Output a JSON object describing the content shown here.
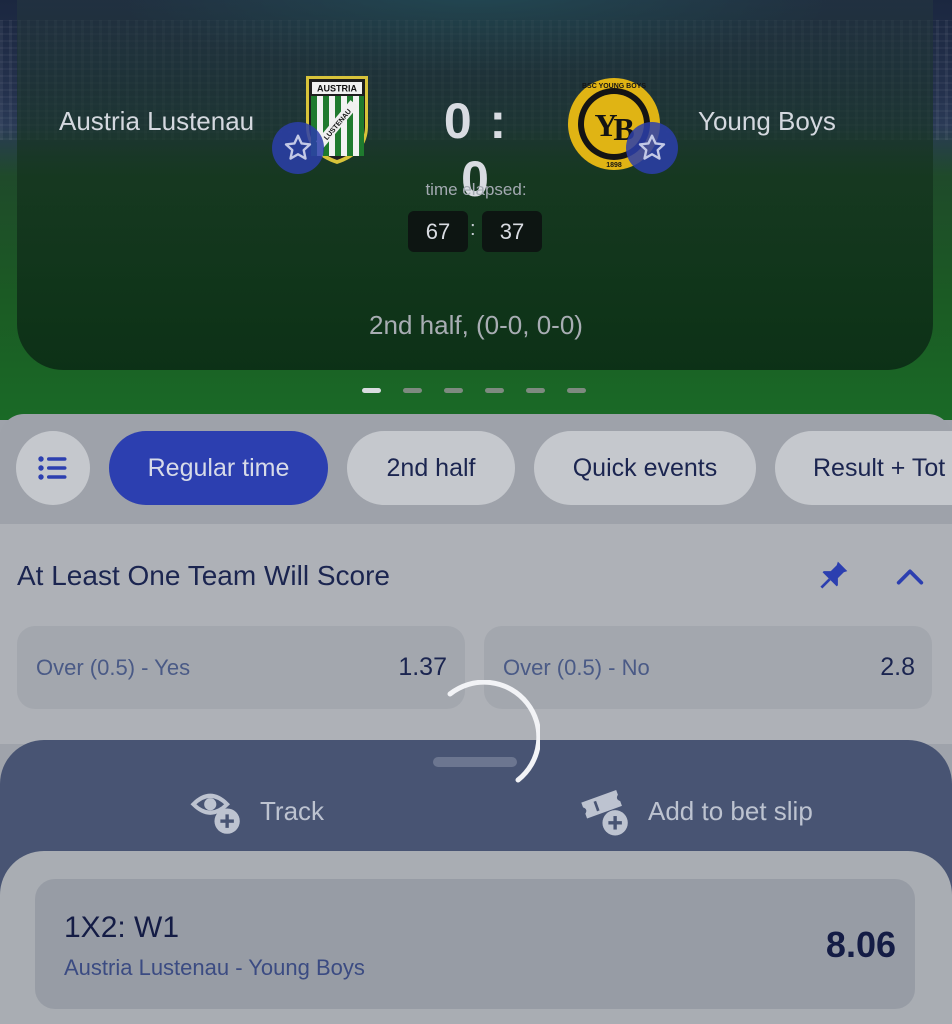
{
  "match": {
    "home_team": "Austria Lustenau",
    "away_team": "Young Boys",
    "home_crest_text": "AUSTRIA",
    "home_crest_sub": "LUSTENAU",
    "away_crest_text": "BSC YOUNG BOYS",
    "away_crest_year": "1898",
    "score": "0 : 0",
    "elapsed_label": "time elapsed:",
    "elapsed_minutes": "67",
    "elapsed_seconds": "37",
    "period": "2nd half, (0-0, 0-0)",
    "carousel_pages": 6,
    "carousel_active": 0
  },
  "tabs": [
    {
      "label": "Regular time",
      "active": true
    },
    {
      "label": "2nd half",
      "active": false
    },
    {
      "label": "Quick events",
      "active": false
    },
    {
      "label": "Result + Tot",
      "active": false
    }
  ],
  "market": {
    "title": "At Least One Team Will Score",
    "outcomes": [
      {
        "label": "Over (0.5) - Yes",
        "odd": "1.37"
      },
      {
        "label": "Over (0.5) - No",
        "odd": "2.8"
      }
    ]
  },
  "sheet": {
    "track_label": "Track",
    "add_label": "Add to bet slip",
    "bet_title": "1X2: W1",
    "bet_match": "Austria Lustenau - Young Boys",
    "bet_odd": "8.06"
  },
  "icons": {
    "menu": "list-icon",
    "pin": "pin-icon",
    "collapse": "chevron-up-icon",
    "favorite": "star-icon",
    "track": "eye-plus-icon",
    "add": "ticket-plus-icon",
    "loading": "spinner-icon"
  },
  "colors": {
    "accent": "#2c3fb0",
    "text_dark": "#1b2550",
    "sheet": "#485473"
  }
}
